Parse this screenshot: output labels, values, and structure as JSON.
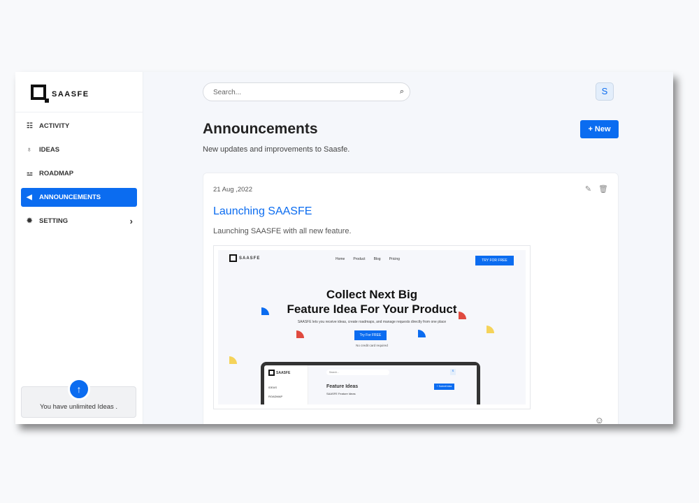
{
  "brand": "SAASFE",
  "sidebar": {
    "items": [
      {
        "label": "ACTIVITY",
        "icon": "list-icon"
      },
      {
        "label": "IDEAS",
        "icon": "lightbulb-icon"
      },
      {
        "label": "ROADMAP",
        "icon": "signpost-icon"
      },
      {
        "label": "ANNOUNCEMENTS",
        "icon": "megaphone-icon",
        "active": true
      },
      {
        "label": "SETTING",
        "icon": "gear-icon"
      }
    ],
    "limit_text": "You have unlimited Ideas ."
  },
  "header": {
    "search_placeholder": "Search...",
    "avatar": "S"
  },
  "page": {
    "title": "Announcements",
    "subtitle": "New updates and improvements to Saasfe.",
    "new_label": "New"
  },
  "announcement": {
    "date": "21 Aug ,2022",
    "title": "Launching SAASFE",
    "description": "Launching SAASFE with all new feature.",
    "preview": {
      "nav": [
        "Home",
        "Product",
        "Blog",
        "Pricing"
      ],
      "try_top": "TRY FOR FREE",
      "headline1": "Collect Next Big",
      "headline2": "Feature Idea For Your Product",
      "tagline": "SAASFE lets you receive ideas, create roadmaps, and manage requests directly from one place",
      "cta": "Try For FREE",
      "note": "No credit card required",
      "inner_title": "Feature Ideas",
      "inner_sub": "SAASFE Feature Ideas",
      "inner_btn": "+ Submit Idea",
      "inner_search": "Search...",
      "inner_nav": [
        "IDEAS",
        "ROADMAP"
      ],
      "inner_avatar": "S"
    }
  },
  "colors": {
    "accent": "#0b6cf0"
  }
}
